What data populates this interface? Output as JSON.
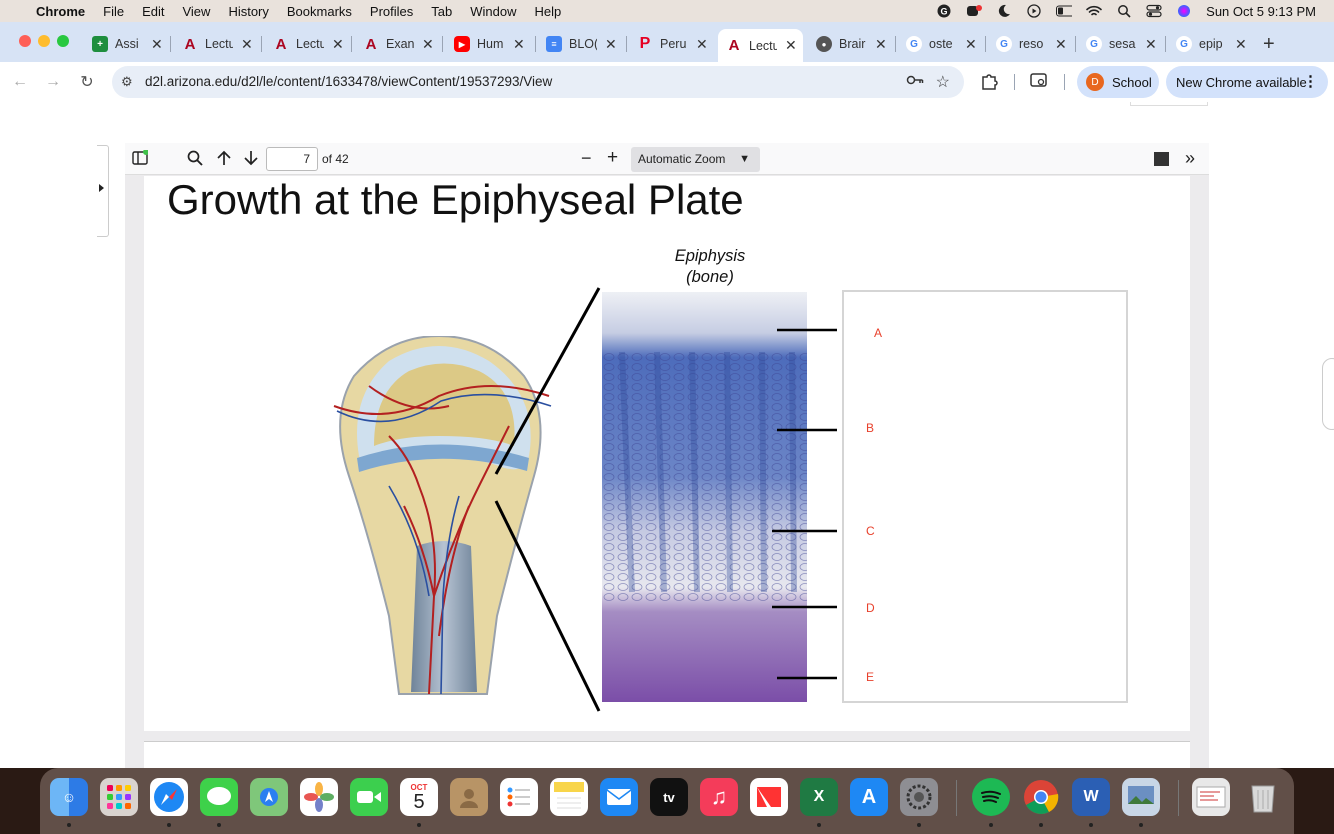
{
  "menubar": {
    "app_name": "Chrome",
    "menus": [
      "File",
      "Edit",
      "View",
      "History",
      "Bookmarks",
      "Profiles",
      "Tab",
      "Window",
      "Help"
    ],
    "datetime": "Sun Oct 5  9:13 PM"
  },
  "tabs": [
    {
      "label": "Assi",
      "icon": "sheets-icon",
      "color": "#1e8e3e"
    },
    {
      "label": "Lectu",
      "icon": "arizona-icon",
      "color": "#ab0520"
    },
    {
      "label": "Lectu",
      "icon": "arizona-icon",
      "color": "#ab0520"
    },
    {
      "label": "Exan",
      "icon": "arizona-icon",
      "color": "#ab0520"
    },
    {
      "label": "Hum",
      "icon": "youtube-icon",
      "color": "#ff0000"
    },
    {
      "label": "BLO(",
      "icon": "docs-icon",
      "color": "#4285f4"
    },
    {
      "label": "Peru",
      "icon": "pinterest-icon",
      "color": "#e60023"
    },
    {
      "label": "Lectu",
      "icon": "arizona-icon",
      "color": "#ab0520"
    },
    {
      "label": "Brair",
      "icon": "panda-icon",
      "color": "#555555"
    },
    {
      "label": "oste",
      "icon": "google-icon",
      "color": "#4285f4"
    },
    {
      "label": "reso",
      "icon": "google-icon",
      "color": "#4285f4"
    },
    {
      "label": "sesa",
      "icon": "google-icon",
      "color": "#4285f4"
    },
    {
      "label": "epip",
      "icon": "google-icon",
      "color": "#4285f4"
    }
  ],
  "toolbar": {
    "url": "d2l.arizona.edu/d2l/le/content/1633478/viewContent/19537293/View",
    "profile_label": "School",
    "profile_initial": "D",
    "update_label": "New Chrome available"
  },
  "pdf": {
    "page_current": "7",
    "page_total": "of 42",
    "zoom": "Automatic Zoom"
  },
  "slide": {
    "title": "Growth at the Epiphyseal Plate",
    "micro_label_line1": "Epiphysis",
    "micro_label_line2": "(bone)",
    "labels": [
      "A",
      "B",
      "C",
      "D",
      "E"
    ],
    "label_color": "#e8412c"
  },
  "dock": {
    "calendar_month": "OCT",
    "calendar_day": "5",
    "apps": [
      "Finder",
      "Launchpad",
      "Safari",
      "Messages",
      "Maps",
      "Photos",
      "FaceTime",
      "Calendar",
      "Contacts",
      "Reminders",
      "Notes",
      "Mail",
      "TV",
      "Music",
      "News",
      "Excel",
      "App Store",
      "System Settings",
      "Spotify",
      "Chrome",
      "Word",
      "Preview",
      "Downloads",
      "Trash"
    ]
  }
}
